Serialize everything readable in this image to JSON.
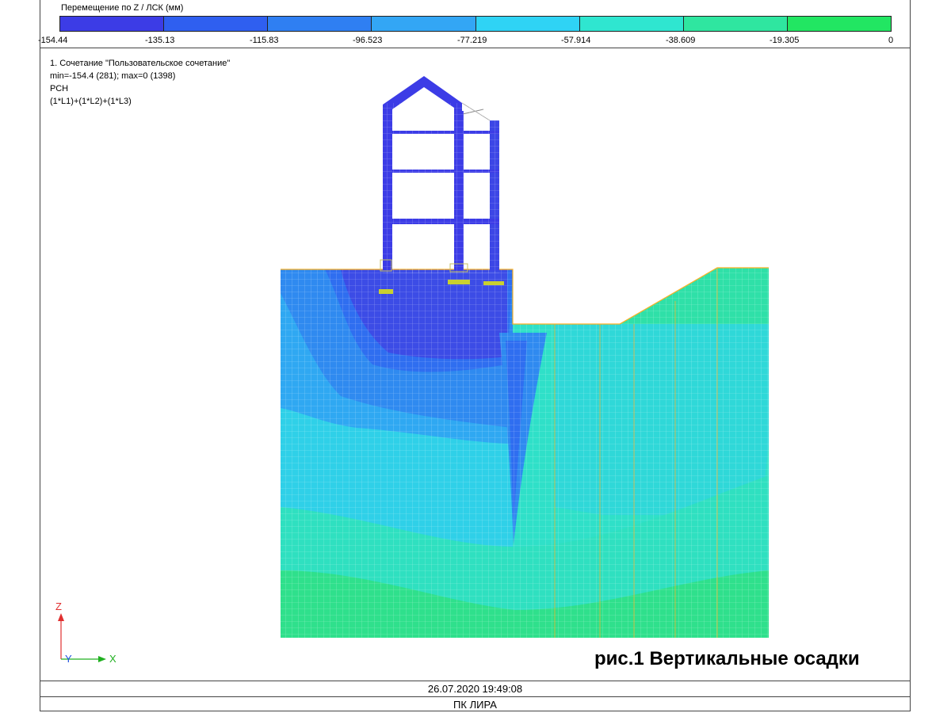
{
  "legend": {
    "title": "Перемещение по Z / ЛСК (мм)",
    "colors": [
      "#3c3ce6",
      "#2f5ff0",
      "#2f7ff2",
      "#33a6f5",
      "#2fd3f5",
      "#2fe6d0",
      "#2fe6a0",
      "#22e662"
    ],
    "ticks": [
      "-154.44",
      "-135.13",
      "-115.83",
      "-96.523",
      "-77.219",
      "-57.914",
      "-38.609",
      "-19.305",
      "0"
    ]
  },
  "info": {
    "line1": "1. Сочетание \"Пользовательское сочетание\"",
    "line2": "min=-154.4 (281); max=0 (1398)",
    "line3": "РСН",
    "line4": "(1*L1)+(1*L2)+(1*L3)"
  },
  "axes": {
    "z": "Z",
    "y": "Y",
    "x": "X"
  },
  "caption": "рис.1 Вертикальные осадки",
  "footer": {
    "datetime": "26.07.2020 19:49:08",
    "app": "ПК ЛИРА"
  }
}
